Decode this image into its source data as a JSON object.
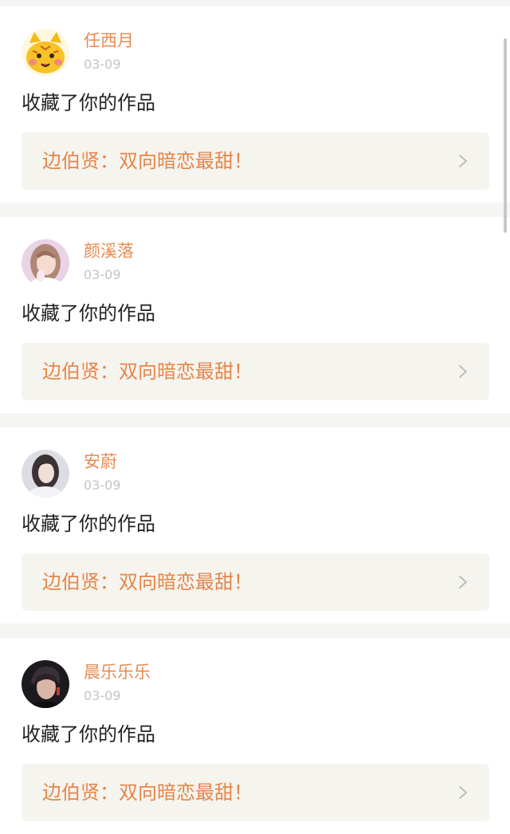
{
  "notifications": [
    {
      "avatar": "cartoon-tiger-avatar",
      "username": "任西月",
      "date": "03-09",
      "action": "收藏了你的作品",
      "work_title": "边伯贤：双向暗恋最甜！"
    },
    {
      "avatar": "girl-pink-background-avatar",
      "username": "颜溪落",
      "date": "03-09",
      "action": "收藏了你的作品",
      "work_title": "边伯贤：双向暗恋最甜！"
    },
    {
      "avatar": "girl-grey-background-avatar",
      "username": "安蔚",
      "date": "03-09",
      "action": "收藏了你的作品",
      "work_title": "边伯贤：双向暗恋最甜！"
    },
    {
      "avatar": "boy-dark-background-avatar",
      "username": "晨乐乐乐",
      "date": "03-09",
      "action": "收藏了你的作品",
      "work_title": "边伯贤：双向暗恋最甜！"
    }
  ],
  "colors": {
    "username": "#e88b52",
    "work_title": "#e6854a",
    "work_link_bg": "#f5f4ee",
    "date": "#c4c4c4",
    "action": "#222222"
  },
  "icons": {
    "chevron": "chevron-right-icon"
  }
}
